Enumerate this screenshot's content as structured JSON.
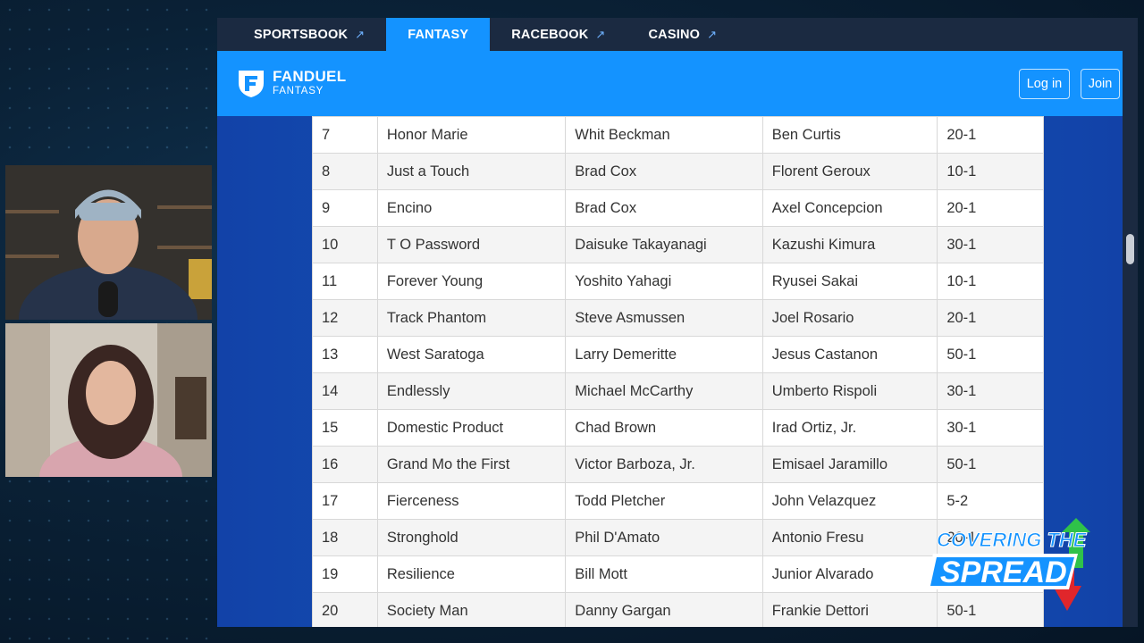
{
  "nav": {
    "tabs": [
      {
        "label": "SPORTSBOOK",
        "external": true,
        "active": false
      },
      {
        "label": "FANTASY",
        "external": false,
        "active": true
      },
      {
        "label": "RACEBOOK",
        "external": true,
        "active": false
      },
      {
        "label": "CASINO",
        "external": true,
        "active": false
      }
    ],
    "external_icon": "↗"
  },
  "header": {
    "brand": "FANDUEL",
    "brand_sub": "FANTASY",
    "login_label": "Log in",
    "join_label": "Join"
  },
  "table": {
    "rows": [
      [
        "7",
        "Honor Marie",
        "Whit Beckman",
        "Ben Curtis",
        "20-1"
      ],
      [
        "8",
        "Just a Touch",
        "Brad Cox",
        "Florent Geroux",
        "10-1"
      ],
      [
        "9",
        "Encino",
        "Brad Cox",
        "Axel Concepcion",
        "20-1"
      ],
      [
        "10",
        "T O Password",
        "Daisuke Takayanagi",
        "Kazushi Kimura",
        "30-1"
      ],
      [
        "11",
        "Forever Young",
        "Yoshito Yahagi",
        "Ryusei Sakai",
        "10-1"
      ],
      [
        "12",
        "Track Phantom",
        "Steve Asmussen",
        "Joel Rosario",
        "20-1"
      ],
      [
        "13",
        "West Saratoga",
        "Larry Demeritte",
        "Jesus Castanon",
        "50-1"
      ],
      [
        "14",
        "Endlessly",
        "Michael McCarthy",
        "Umberto Rispoli",
        "30-1"
      ],
      [
        "15",
        "Domestic Product",
        "Chad Brown",
        "Irad Ortiz, Jr.",
        "30-1"
      ],
      [
        "16",
        "Grand Mo the First",
        "Victor Barboza, Jr.",
        "Emisael Jaramillo",
        "50-1"
      ],
      [
        "17",
        "Fierceness",
        "Todd Pletcher",
        "John Velazquez",
        "5-2"
      ],
      [
        "18",
        "Stronghold",
        "Phil D'Amato",
        "Antonio Fresu",
        "20-1"
      ],
      [
        "19",
        "Resilience",
        "Bill Mott",
        "Junior Alvarado",
        ""
      ],
      [
        "20",
        "Society Man",
        "Danny Gargan",
        "Frankie Dettori",
        "50-1"
      ]
    ]
  },
  "overlay": {
    "line1": "COVERING THE",
    "line2": "SPREAD"
  },
  "colors": {
    "fanduel_blue": "#1493ff",
    "nav_dark": "#1b2a41",
    "page_blue": "#1556b8"
  }
}
